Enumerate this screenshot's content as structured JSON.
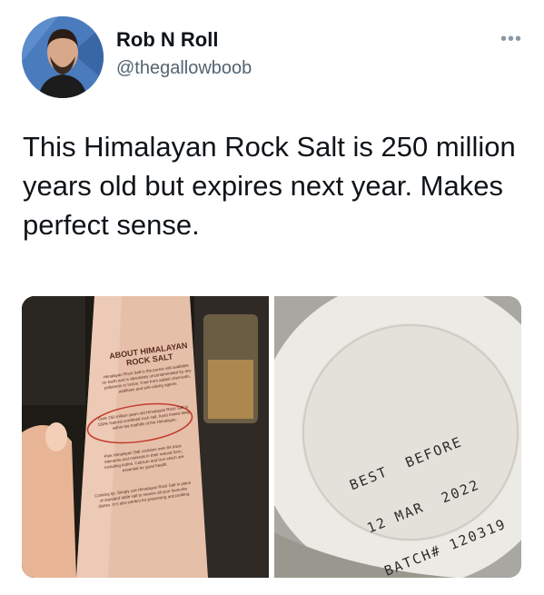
{
  "author": {
    "display_name": "Rob N Roll",
    "handle": "@thegallowboob"
  },
  "more_icon": "•••",
  "tweet": {
    "text": "This Himalayan Rock Salt is 250 million years old but expires next year. Makes perfect sense."
  },
  "media": {
    "left_photo": {
      "label_title_1": "ABOUT HIMALAYAN",
      "label_title_2": "ROCK SALT",
      "label_body_1": "Himalayan Rock Salt is the purest salt available on earth and is absolutely uncontaminated by any pollutants or toxins. Free from added chemicals, additives and anti-caking agents.",
      "label_body_2": "Over 250 million years old Himalayan Rock Salt is 100% Natural unrefined rock salt, hand mined deep within the foothills of the Himalayas.",
      "label_body_3": "Pink Himalayan Salt contains over 84 trace elements and minerals in their natural form, including iodine. Calcium and Iron which are essential for good health.",
      "label_body_4": "Cooking tip: Simply use Himalayan Rock Salt in place of standard table salt to season all your favourite dishes. It is also perfect for preserving and pickling."
    },
    "right_photo": {
      "stamp_line_1": "BEST  BEFORE",
      "stamp_line_2": "12 MAR  2022",
      "stamp_line_3": "BATCH# 120319"
    }
  },
  "colors": {
    "text_primary": "#0f1419",
    "text_secondary": "#536471"
  }
}
